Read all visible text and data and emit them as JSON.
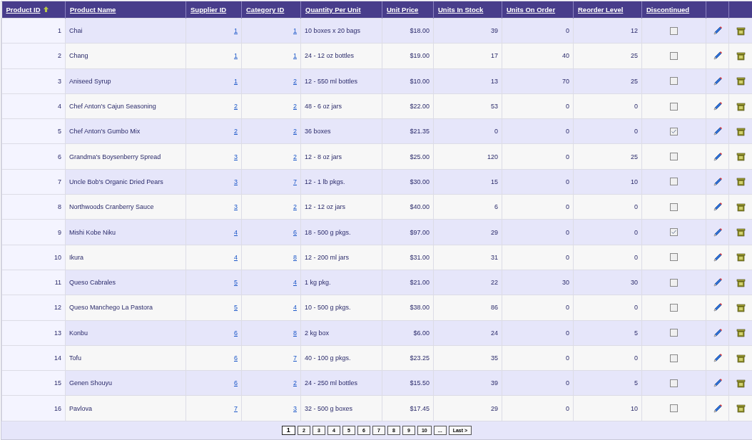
{
  "table": {
    "columns": [
      {
        "label": "Product ID",
        "sorted": true
      },
      {
        "label": "Product Name",
        "sorted": false
      },
      {
        "label": "Supplier ID",
        "sorted": false
      },
      {
        "label": "Category ID",
        "sorted": false
      },
      {
        "label": "Quantity Per Unit",
        "sorted": false
      },
      {
        "label": "Unit Price",
        "sorted": false
      },
      {
        "label": "Units In Stock",
        "sorted": false
      },
      {
        "label": "Units On Order",
        "sorted": false
      },
      {
        "label": "Reorder Level",
        "sorted": false
      },
      {
        "label": "Discontinued",
        "sorted": false
      }
    ],
    "rows": [
      {
        "id": "1",
        "name": "Chai",
        "supplier": "1",
        "category": "1",
        "quantity": "10 boxes x 20 bags",
        "price": "$18.00",
        "stock": "39",
        "on_order": "0",
        "reorder": "12",
        "discontinued": false
      },
      {
        "id": "2",
        "name": "Chang",
        "supplier": "1",
        "category": "1",
        "quantity": "24 - 12 oz bottles",
        "price": "$19.00",
        "stock": "17",
        "on_order": "40",
        "reorder": "25",
        "discontinued": false
      },
      {
        "id": "3",
        "name": "Aniseed Syrup",
        "supplier": "1",
        "category": "2",
        "quantity": "12 - 550 ml bottles",
        "price": "$10.00",
        "stock": "13",
        "on_order": "70",
        "reorder": "25",
        "discontinued": false
      },
      {
        "id": "4",
        "name": "Chef Anton's Cajun Seasoning",
        "supplier": "2",
        "category": "2",
        "quantity": "48 - 6 oz jars",
        "price": "$22.00",
        "stock": "53",
        "on_order": "0",
        "reorder": "0",
        "discontinued": false
      },
      {
        "id": "5",
        "name": "Chef Anton's Gumbo Mix",
        "supplier": "2",
        "category": "2",
        "quantity": "36 boxes",
        "price": "$21.35",
        "stock": "0",
        "on_order": "0",
        "reorder": "0",
        "discontinued": true
      },
      {
        "id": "6",
        "name": "Grandma's Boysenberry Spread",
        "supplier": "3",
        "category": "2",
        "quantity": "12 - 8 oz jars",
        "price": "$25.00",
        "stock": "120",
        "on_order": "0",
        "reorder": "25",
        "discontinued": false
      },
      {
        "id": "7",
        "name": "Uncle Bob's Organic Dried Pears",
        "supplier": "3",
        "category": "7",
        "quantity": "12 - 1 lb pkgs.",
        "price": "$30.00",
        "stock": "15",
        "on_order": "0",
        "reorder": "10",
        "discontinued": false
      },
      {
        "id": "8",
        "name": "Northwoods Cranberry Sauce",
        "supplier": "3",
        "category": "2",
        "quantity": "12 - 12 oz jars",
        "price": "$40.00",
        "stock": "6",
        "on_order": "0",
        "reorder": "0",
        "discontinued": false
      },
      {
        "id": "9",
        "name": "Mishi Kobe Niku",
        "supplier": "4",
        "category": "6",
        "quantity": "18 - 500 g pkgs.",
        "price": "$97.00",
        "stock": "29",
        "on_order": "0",
        "reorder": "0",
        "discontinued": true
      },
      {
        "id": "10",
        "name": "Ikura",
        "supplier": "4",
        "category": "8",
        "quantity": "12 - 200 ml jars",
        "price": "$31.00",
        "stock": "31",
        "on_order": "0",
        "reorder": "0",
        "discontinued": false
      },
      {
        "id": "11",
        "name": "Queso Cabrales",
        "supplier": "5",
        "category": "4",
        "quantity": "1 kg pkg.",
        "price": "$21.00",
        "stock": "22",
        "on_order": "30",
        "reorder": "30",
        "discontinued": false
      },
      {
        "id": "12",
        "name": "Queso Manchego La Pastora",
        "supplier": "5",
        "category": "4",
        "quantity": "10 - 500 g pkgs.",
        "price": "$38.00",
        "stock": "86",
        "on_order": "0",
        "reorder": "0",
        "discontinued": false
      },
      {
        "id": "13",
        "name": "Konbu",
        "supplier": "6",
        "category": "8",
        "quantity": "2 kg box",
        "price": "$6.00",
        "stock": "24",
        "on_order": "0",
        "reorder": "5",
        "discontinued": false
      },
      {
        "id": "14",
        "name": "Tofu",
        "supplier": "6",
        "category": "7",
        "quantity": "40 - 100 g pkgs.",
        "price": "$23.25",
        "stock": "35",
        "on_order": "0",
        "reorder": "0",
        "discontinued": false
      },
      {
        "id": "15",
        "name": "Genen Shouyu",
        "supplier": "6",
        "category": "2",
        "quantity": "24 - 250 ml bottles",
        "price": "$15.50",
        "stock": "39",
        "on_order": "0",
        "reorder": "5",
        "discontinued": false
      },
      {
        "id": "16",
        "name": "Pavlova",
        "supplier": "7",
        "category": "3",
        "quantity": "32 - 500 g boxes",
        "price": "$17.45",
        "stock": "29",
        "on_order": "0",
        "reorder": "10",
        "discontinued": false
      }
    ]
  },
  "pager": [
    {
      "label": "1",
      "selected": true
    },
    {
      "label": "2",
      "selected": false
    },
    {
      "label": "3",
      "selected": false
    },
    {
      "label": "4",
      "selected": false
    },
    {
      "label": "5",
      "selected": false
    },
    {
      "label": "6",
      "selected": false
    },
    {
      "label": "7",
      "selected": false
    },
    {
      "label": "8",
      "selected": false
    },
    {
      "label": "9",
      "selected": false
    },
    {
      "label": "10",
      "selected": false
    },
    {
      "label": "...",
      "selected": false
    },
    {
      "label": "Last >",
      "selected": false
    }
  ]
}
